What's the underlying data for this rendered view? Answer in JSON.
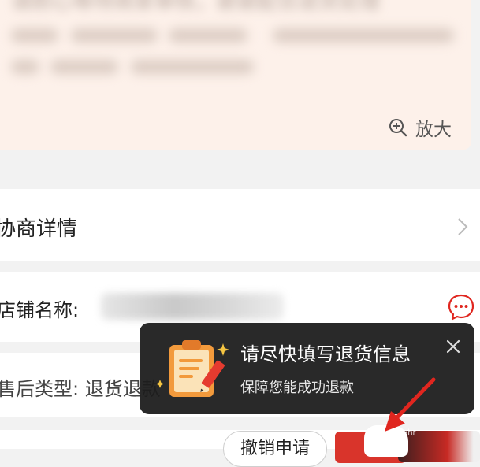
{
  "note_card": {
    "blurred_line_1": "请耐心等待商家审核，谢谢配合退货处理",
    "zoom_label": "放大",
    "zoom_icon": "zoom-in-icon"
  },
  "merchant_row": {
    "label": "协商详情",
    "chevron_icon": "chevron-right-icon"
  },
  "store_row": {
    "label": "店铺名称:",
    "chat_icon": "chat-bubble-icon"
  },
  "aftersale_row": {
    "label": "售后类型: 退货退款"
  },
  "bottom_bar": {
    "withdraw_label": "撤销申请",
    "watermark": "shr"
  },
  "tooltip": {
    "title": "请尽快填写退货信息",
    "subtitle": "保障您能成功退款",
    "icon": "clipboard-pencil-icon",
    "close_icon": "close-icon"
  },
  "colors": {
    "accent_red": "#d9342b",
    "arrow_red": "#e0261f",
    "note_bg": "#fdf1ea",
    "tooltip_bg": "#1c1c1c"
  }
}
